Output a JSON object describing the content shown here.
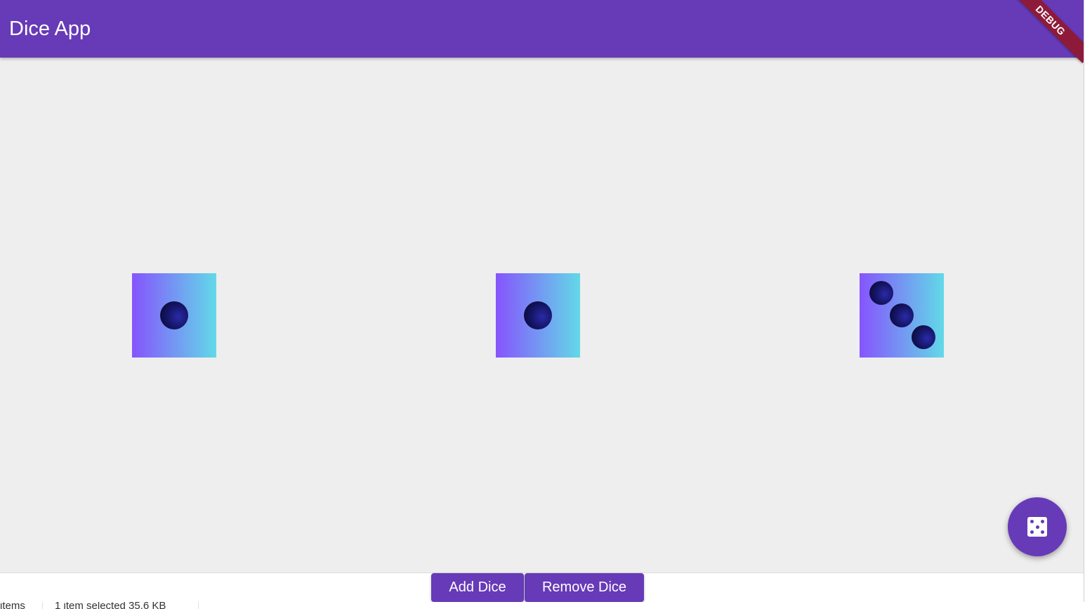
{
  "appbar": {
    "title": "Dice App",
    "debug_banner": "DEBUG"
  },
  "dice": [
    {
      "value": 1
    },
    {
      "value": 1
    },
    {
      "value": 3
    }
  ],
  "fab": {
    "icon": "dice-icon"
  },
  "buttons": {
    "add_label": "Add Dice",
    "remove_label": "Remove Dice"
  },
  "statusbar": {
    "items_text": "items",
    "selection_text": "1 item selected  35.6 KB"
  },
  "colors": {
    "primary": "#673ab7",
    "background": "#eeeeee",
    "die_gradient_start": "#8654fd",
    "die_gradient_end": "#62d9e8",
    "debug_banner": "#8e1a3a"
  }
}
